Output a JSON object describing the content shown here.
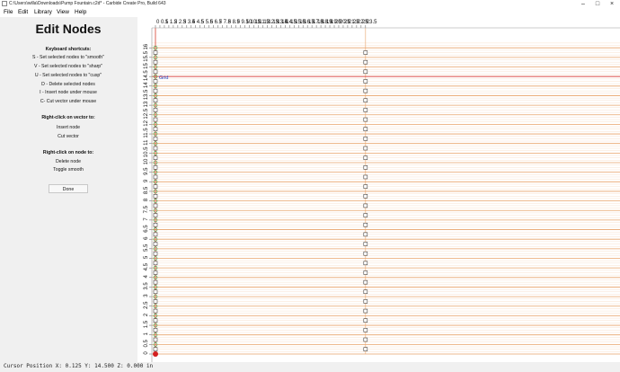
{
  "window": {
    "title": "C:\\Users\\willa\\Downloads\\Pump Fountain.c2d* - Carbide Create Pro, Build 643",
    "minimize_icon": "minimize-icon",
    "maximize_icon": "maximize-icon",
    "close_icon": "close-icon"
  },
  "menu": [
    "File",
    "Edit",
    "Library",
    "View",
    "Help"
  ],
  "panel": {
    "heading": "Edit Nodes",
    "shortcuts_title": "Keyboard shortcuts:",
    "shortcuts": [
      "S - Set selected nodes to \"smooth\"",
      "V - Set selected nodes to \"sharp\"",
      "U - Set selected nodes to \"cusp\"",
      "D - Delete selected nodes",
      "I - Insert node under mouse",
      "C- Cut vector under mouse"
    ],
    "vector_title": "Right-click on vector to:",
    "vector_actions": [
      "Insert node",
      "Cut vector"
    ],
    "node_title": "Right-click on node to:",
    "node_actions": [
      "Delete node",
      "Toggle smooth"
    ],
    "done_label": "Done"
  },
  "canvas": {
    "grid_label": "Grid",
    "x_ticks": [
      "0",
      "0.5",
      "1",
      "1.5",
      "2",
      "2.5",
      "3",
      "3.5",
      "4",
      "4.5",
      "5",
      "5.5",
      "6",
      "6.5",
      "7",
      "7.5",
      "8",
      "8.5",
      "9",
      "9.5",
      "10",
      "10.5",
      "11",
      "11.5",
      "12",
      "12.5",
      "13",
      "13.5",
      "14",
      "14.5",
      "15",
      "15.5",
      "16",
      "16.5",
      "17",
      "17.5",
      "18",
      "18.5",
      "19",
      "19.5",
      "20",
      "20.5",
      "21",
      "21.5",
      "22",
      "22.5",
      "23",
      "23.5"
    ],
    "y_ticks": [
      "16",
      "15.5",
      "15",
      "14.5",
      "14",
      "13.5",
      "13",
      "12.5",
      "12",
      "11.5",
      "11",
      "10.5",
      "10",
      "9.5",
      "9",
      "8.5",
      "8",
      "7.5",
      "7",
      "6.5",
      "6",
      "5.5",
      "5",
      "4.5",
      "4",
      "3.5",
      "3",
      "2.5",
      "2",
      "1.5",
      "1",
      "0.5",
      "0"
    ],
    "x_range": [
      0,
      23.7
    ],
    "y_range": [
      0,
      16.3
    ],
    "cursor_marker": {
      "x": 0,
      "y": 14.5
    },
    "colors": {
      "background": "#ffffff",
      "grid_major": "#e8a36a",
      "grid_minor": "#f6d9c2",
      "red_line": "#d32020",
      "node_green": "#2e9a3a",
      "node_border": "#222222",
      "label_blue": "#2040c0"
    }
  },
  "status": {
    "text": "Cursor Position X: 0.125 Y: 14.500 Z: 0.000 in"
  }
}
